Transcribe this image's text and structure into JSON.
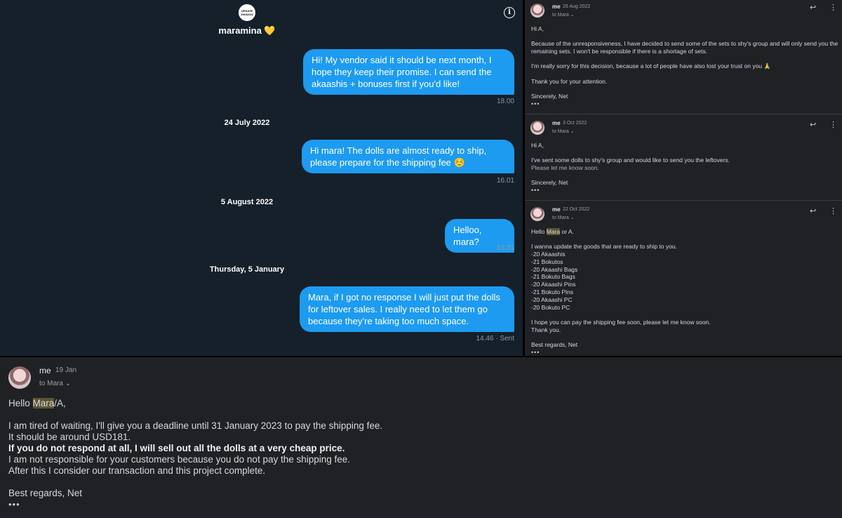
{
  "dm": {
    "avatar_text": "UPDATE 19102022",
    "name": "maramina 💛",
    "messages": [
      {
        "text": "Hi! My vendor said it should be next month, I hope they keep their promise. I can send the akaashis + bonuses first if you'd like!",
        "time": "18.00"
      },
      {
        "text": "Hi mara! The dolls are almost ready to ship, please prepare for the shipping fee ☺️",
        "time": "16.01"
      },
      {
        "text": "Helloo, mara?",
        "time": "15.31"
      },
      {
        "text": "Mara, if I got no response I will just put the dolls for leftover sales. I really need to let them go because they’re taking too much space.",
        "time": "14.46 · Sent"
      }
    ],
    "dates": [
      "24 July 2022",
      "5 August 2022",
      "Thursday, 5 January"
    ]
  },
  "mails": [
    {
      "from": "me",
      "date": "26 Aug 2022",
      "to": "to Mara ⌄",
      "lines": [
        "Hi A,",
        "",
        "Because of the unresponsiveness, I have decided to send some of the sets to shy's group and will only send you the remaining sets. I won't be responsible if there is a shortage of sets.",
        "",
        "I'm really sorry for this decision, because a lot of people have also lost your trust on you 🙏",
        "",
        "Thank you for your attention.",
        "",
        "Sincerely, Net"
      ]
    },
    {
      "from": "me",
      "date": "3 Oct 2022",
      "to": "to Mara ⌄",
      "lines": [
        "Hi A,",
        "",
        "I've sent some dolls to shy's group and would like to send you the leftovers.",
        "Please let me know soon.",
        "",
        "Sincerely, Net"
      ]
    },
    {
      "from": "me",
      "date": "22 Oct 2022",
      "to": "to Mara ⌄",
      "greeting_pre": "Hello ",
      "greeting_hl": "Mara",
      "greeting_post": " or A.",
      "lines": [
        "",
        "I wanna update the goods that are ready to ship to you.",
        "-20 Akaashis",
        "-21 Bokutos",
        "-20 Akaashi Bags",
        "-21 Bokuto Bags",
        "-20 Akaashi Pins",
        "-21 Bokuto Pins",
        "-20 Akaashi PC",
        "-20 Bokuto PC",
        "",
        "I hope you can pay the shipping fee soon, please let me know soon.",
        "Thank you.",
        "",
        "Best regards, Net"
      ]
    }
  ],
  "mail_bottom": {
    "from": "me",
    "date": "19 Jan",
    "to": "to Mara ⌄",
    "greeting_pre": "Hello ",
    "greeting_hl": "Mara",
    "greeting_post": "/A,",
    "line1": "I am tired of waiting, I'll give you a deadline until 31 January 2023 to pay the shipping fee.",
    "line2": "It should be around USD181.",
    "line3": "If you do not respond at all, I will sell out all the dolls at a very cheap price.",
    "line4": "I am not responsible for your customers because you do not pay the shipping fee.",
    "line5": "After this I consider our transaction and this project complete.",
    "signoff": "Best regards, Net"
  },
  "icons": {
    "dots": "•••",
    "reply": "↩",
    "more": "⋮",
    "info": "i"
  }
}
